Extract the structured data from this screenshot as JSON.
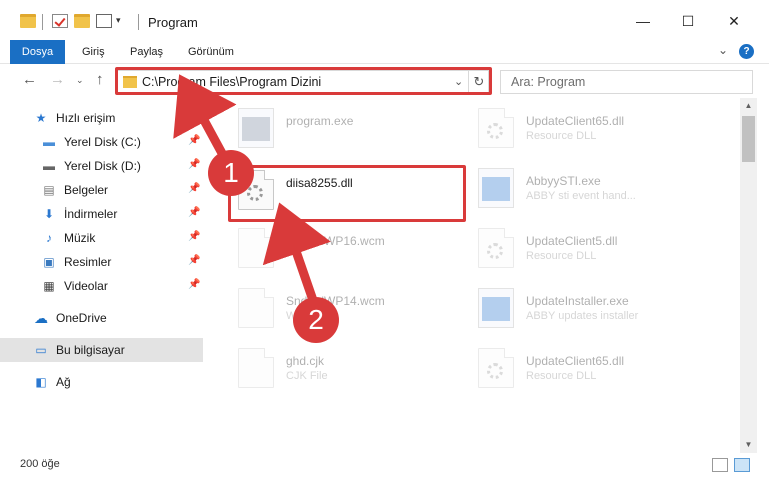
{
  "window": {
    "title": "Program",
    "minimize": "—",
    "maximize": "☐",
    "close": "✕"
  },
  "ribbon": {
    "tabs": [
      "Dosya",
      "Giriş",
      "Paylaş",
      "Görünüm"
    ]
  },
  "address_bar": {
    "path": "C:\\Program Files\\Program Dizini",
    "search_placeholder": "Ara: Program"
  },
  "sidebar": {
    "items": [
      {
        "label": "Hızlı erişim",
        "icon": "star-icon"
      },
      {
        "label": "Yerel Disk (C:)",
        "icon": "drive-icon"
      },
      {
        "label": "Yerel Disk (D:)",
        "icon": "drive-icon"
      },
      {
        "label": "Belgeler",
        "icon": "documents-icon"
      },
      {
        "label": "İndirmeler",
        "icon": "download-icon"
      },
      {
        "label": "Müzik",
        "icon": "music-icon"
      },
      {
        "label": "Resimler",
        "icon": "pictures-icon"
      },
      {
        "label": "Videolar",
        "icon": "videos-icon"
      },
      {
        "label": "OneDrive",
        "icon": "cloud-icon"
      },
      {
        "label": "Bu bilgisayar",
        "icon": "computer-icon"
      },
      {
        "label": "Ağ",
        "icon": "network-icon"
      }
    ]
  },
  "files": {
    "left": [
      {
        "name": "program.exe",
        "type": ""
      },
      {
        "name": "diisa8255.dll",
        "type": ""
      },
      {
        "name": "SndVolWP16.wcm",
        "type": ""
      },
      {
        "name": "SndVolWP14.wcm",
        "type": "WCM"
      },
      {
        "name": "ghd.cjk",
        "type": "CJK File"
      }
    ],
    "right": [
      {
        "name": "UpdateClient65.dll",
        "type": "Resource DLL"
      },
      {
        "name": "AbbyySTI.exe",
        "type": "ABBY sti event hand..."
      },
      {
        "name": "UpdateClient5.dll",
        "type": "Resource DLL"
      },
      {
        "name": "UpdateInstaller.exe",
        "type": "ABBY updates installer"
      },
      {
        "name": "UpdateClient65.dll",
        "type": "Resource DLL"
      }
    ]
  },
  "status": {
    "item_count": "200 öğe"
  },
  "annotations": {
    "step1": "1",
    "step2": "2",
    "color": "#d93a3a"
  }
}
